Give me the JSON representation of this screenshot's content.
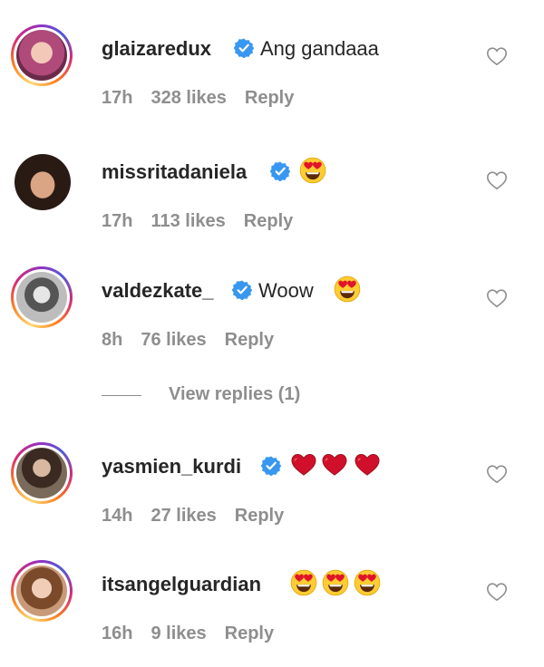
{
  "comments": [
    {
      "username": "glaizaredux",
      "text": "Ang gandaaa",
      "time": "17h",
      "likes": "328 likes",
      "reply": "Reply"
    },
    {
      "username": "missritadaniela",
      "text": "",
      "time": "17h",
      "likes": "113 likes",
      "reply": "Reply"
    },
    {
      "username": "valdezkate_",
      "text": "Woow",
      "time": "8h",
      "likes": "76 likes",
      "reply": "Reply"
    },
    {
      "username": "yasmien_kurdi",
      "text": "",
      "time": "14h",
      "likes": "27 likes",
      "reply": "Reply"
    },
    {
      "username": "itsangelguardian",
      "text": "",
      "time": "16h",
      "likes": "9 likes",
      "reply": "Reply"
    }
  ],
  "view_replies": "View replies (1)",
  "icons": {
    "verified": "verified-badge-icon",
    "heart": "heart-outline-icon",
    "heart_eyes": "heart-eyes-emoji",
    "red_heart": "red-heart-emoji"
  },
  "colors": {
    "verified": "#3897f0",
    "meta": "#8e8e8e",
    "text": "#262626"
  }
}
